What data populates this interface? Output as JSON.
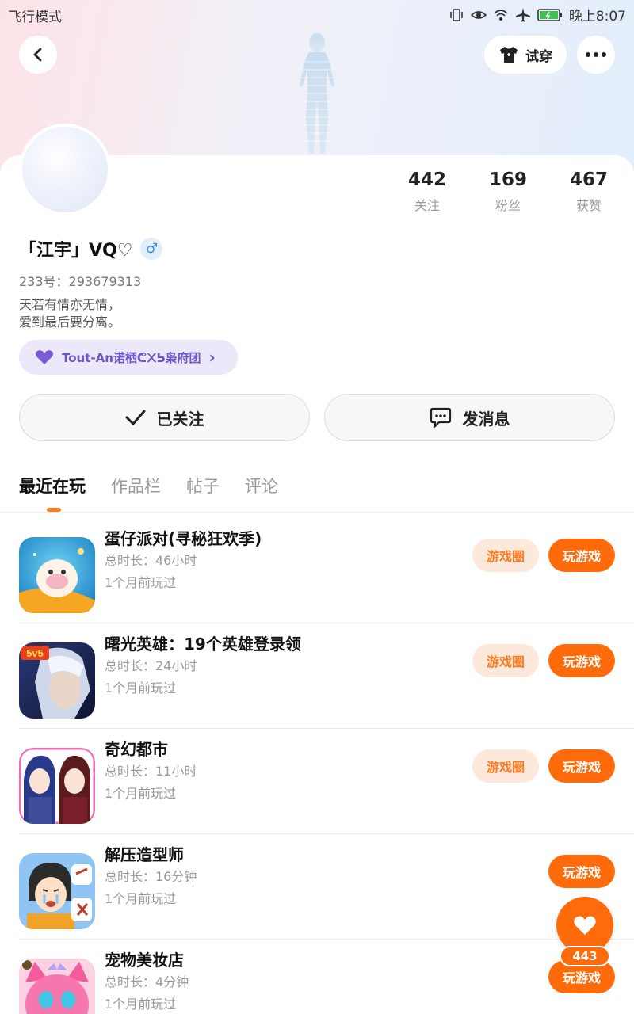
{
  "status_bar": {
    "left_text": "飞行模式",
    "time": "晚上8:07",
    "icons": [
      "vibrate-icon",
      "eye-icon",
      "wifi-icon",
      "airplane-icon",
      "battery-icon"
    ]
  },
  "header": {
    "back_icon": "back-arrow-icon",
    "tryon_label": "试穿",
    "tryon_icon": "tshirt-icon",
    "more_icon": "more-dots-icon"
  },
  "profile": {
    "stats": [
      {
        "value": "442",
        "label": "关注"
      },
      {
        "value": "169",
        "label": "粉丝"
      },
      {
        "value": "467",
        "label": "获赞"
      }
    ],
    "name": "「江宇」VQ♡",
    "gender_symbol": "♂",
    "id_text": "233号：293679313",
    "bio": "天若有情亦无情，\n爱到最后要分离。",
    "guild_label": "Tout-An诺栖ᕦ᙭ᕊ枭府团",
    "guild_arrow": "›"
  },
  "actions": {
    "follow_label": "已关注",
    "message_label": "发消息"
  },
  "tabs": [
    "最近在玩",
    "作品栏",
    "帖子",
    "评论"
  ],
  "games": [
    {
      "name": "蛋仔派对(寻秘狂欢季)",
      "duration": "总时长：46小时",
      "last_played": "1个月前玩过",
      "circle_label": "游戏圈",
      "play_label": "玩游戏",
      "has_circle": true
    },
    {
      "name": "曙光英雄：19个英雄登录领",
      "duration": "总时长：24小时",
      "last_played": "1个月前玩过",
      "circle_label": "游戏圈",
      "play_label": "玩游戏",
      "has_circle": true,
      "badge": "5v5"
    },
    {
      "name": "奇幻都市",
      "duration": "总时长：11小时",
      "last_played": "1个月前玩过",
      "circle_label": "游戏圈",
      "play_label": "玩游戏",
      "has_circle": true
    },
    {
      "name": "解压造型师",
      "duration": "总时长：16分钟",
      "last_played": "1个月前玩过",
      "play_label": "玩游戏",
      "has_circle": false
    },
    {
      "name": "宠物美妆店",
      "duration": "总时长：4分钟",
      "last_played": "1个月前玩过",
      "play_label": "玩游戏",
      "has_circle": false
    }
  ],
  "like_fab": {
    "count": "443",
    "icon": "heart-icon"
  },
  "colors": {
    "accent": "#ff6a0a",
    "accent_light": "#fde8dc",
    "guild_bg": "#ece8fa",
    "guild_text": "#6a56c9"
  }
}
